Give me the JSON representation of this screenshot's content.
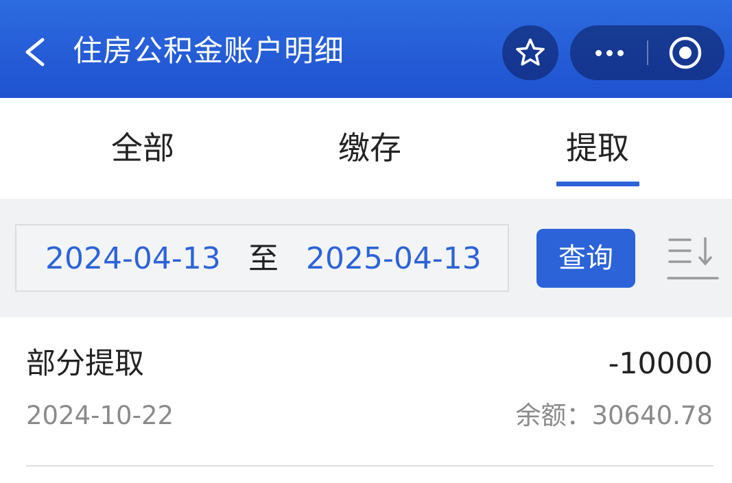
{
  "header": {
    "title": "住房公积金账户明细",
    "back_icon": "chevron-left-icon",
    "favorite_icon": "star-outline-icon",
    "more_icon": "more-dots-icon",
    "close_icon": "target-circle-icon",
    "bg_color": "#1f52cf"
  },
  "tabs": [
    {
      "label": "全部",
      "active": false
    },
    {
      "label": "缴存",
      "active": false
    },
    {
      "label": "提取",
      "active": true
    }
  ],
  "filter": {
    "start_date": "2024-04-13",
    "separator": "至",
    "end_date": "2025-04-13",
    "query_label": "查询",
    "sort_icon": "sort-descending-icon"
  },
  "records": [
    {
      "type": "部分提取",
      "amount": "-10000",
      "date": "2024-10-22",
      "balance": "余额：30640.78"
    }
  ],
  "colors": {
    "accent": "#2c63d8",
    "text_primary": "#222222",
    "text_secondary": "#8a8a8a",
    "filter_bg": "#f1f2f4"
  }
}
